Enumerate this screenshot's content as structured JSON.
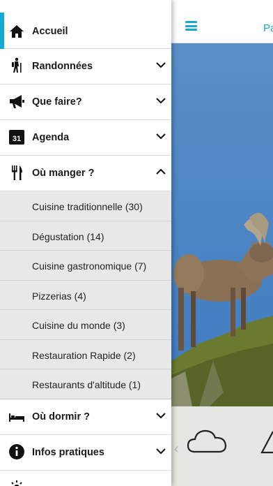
{
  "app_bar": {
    "title": "Pa"
  },
  "menu": {
    "items": [
      {
        "label": "Accueil",
        "icon": "house-icon"
      },
      {
        "label": "Randonnées",
        "icon": "hiker-icon"
      },
      {
        "label": "Que faire?",
        "icon": "megaphone-icon"
      },
      {
        "label": "Agenda",
        "icon": "calendar-icon",
        "icon_text": "31"
      },
      {
        "label": "Où manger ?",
        "icon": "cutlery-icon"
      },
      {
        "label": "Où dormir ?",
        "icon": "bed-icon"
      },
      {
        "label": "Infos pratiques",
        "icon": "info-icon"
      }
    ],
    "submenu": [
      {
        "label": "Cuisine traditionnelle (30)"
      },
      {
        "label": "Dégustation (14)"
      },
      {
        "label": "Cuisine gastronomique (7)"
      },
      {
        "label": "Pizzerias (4)"
      },
      {
        "label": "Cuisine du monde (3)"
      },
      {
        "label": "Restauration Rapide (2)"
      },
      {
        "label": "Restaurants d'altitude (1)"
      }
    ]
  },
  "colors": {
    "accent": "#14a8d6",
    "submenu_bg": "#e8e8e8"
  }
}
